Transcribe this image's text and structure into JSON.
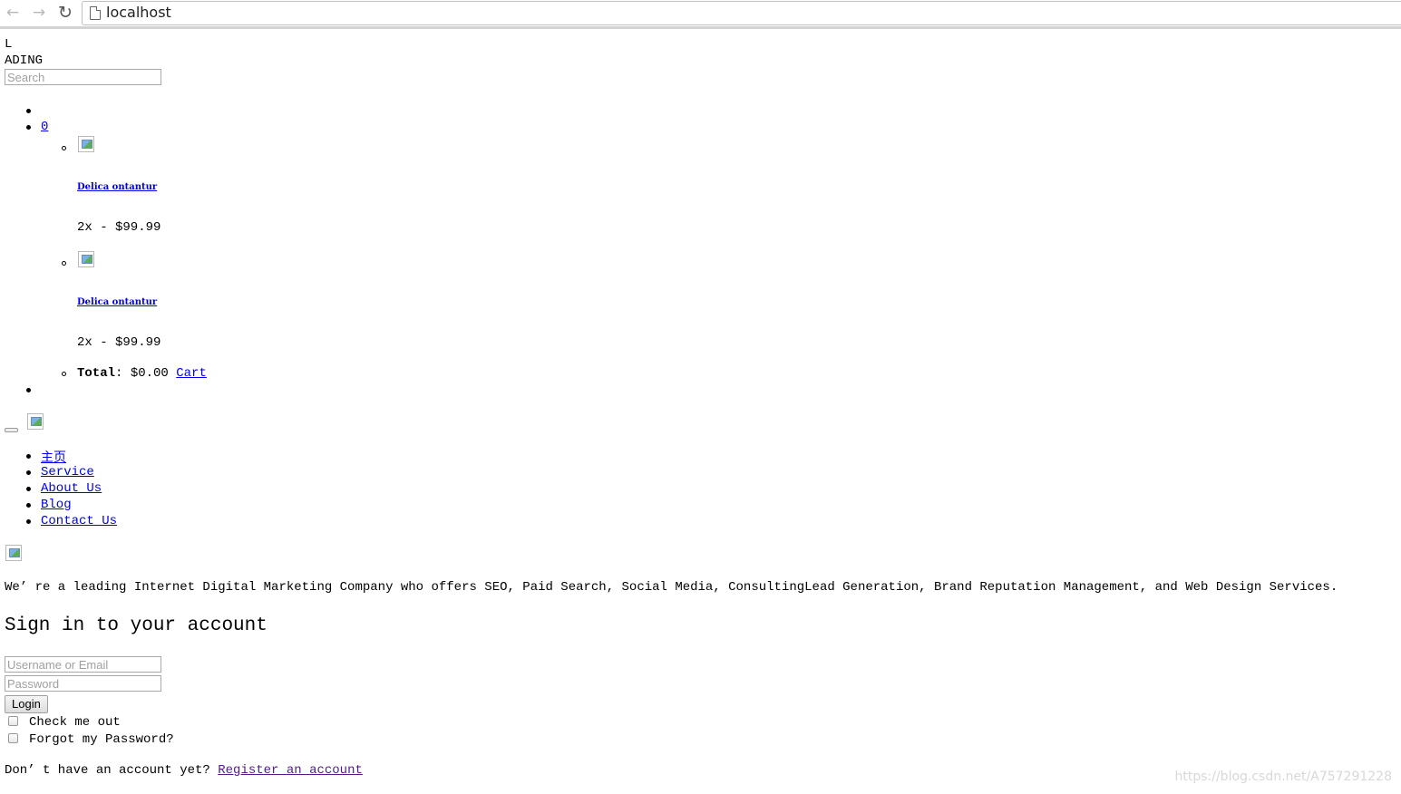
{
  "browser": {
    "url": "localhost"
  },
  "preloader": {
    "line1": "L",
    "line2": "ADING"
  },
  "search": {
    "placeholder": "Search"
  },
  "cart": {
    "count": "0",
    "items": [
      {
        "name": "Delica ontantur",
        "price": "2x - $99.99"
      },
      {
        "name": "Delica ontantur",
        "price": "2x - $99.99"
      }
    ],
    "total_label": "Total",
    "total_value": "$0.00",
    "cart_link": "Cart"
  },
  "nav": {
    "items": [
      "主页",
      "Service",
      "About Us",
      "Blog",
      "Contact Us"
    ]
  },
  "intro": {
    "text": "We’ re a leading Internet Digital Marketing Company who offers SEO, Paid Search, Social Media, ConsultingLead Generation, Brand Reputation Management, and Web Design Services."
  },
  "signin": {
    "title": "Sign in to your account",
    "username_placeholder": "Username or Email",
    "password_placeholder": "Password",
    "login_label": "Login",
    "check_label": "Check me out",
    "forgot_label": "Forgot my Password?",
    "no_account_text": "Don’ t have an account yet?",
    "register_link": "Register an account"
  },
  "watermark": "https://blog.csdn.net/A757291228"
}
